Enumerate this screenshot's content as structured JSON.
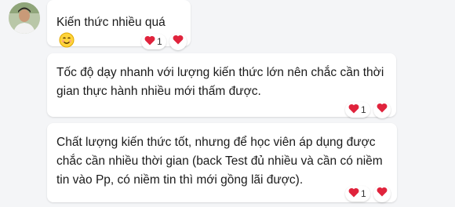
{
  "messages": [
    {
      "text": "Kiến thức nhiều quá",
      "emoji": "smiling-face-emoji",
      "reaction_icon": "heart-icon",
      "reaction_count": "1",
      "react_button_icon": "heart-icon"
    },
    {
      "text": "Tốc độ dạy nhanh với lượng kiến thức lớn nên chắc cần thời\ngian thực hành nhiều mới thấm được.",
      "reaction_icon": "heart-icon",
      "reaction_count": "1",
      "react_button_icon": "heart-icon"
    },
    {
      "text": "Chất lượng kiến thức tốt, nhưng để học viên áp dụng được\nchắc cần nhiều thời gian (back Test đủ nhiều và cần có niềm\ntin vào Pp, có niềm tin thì mới gồng lãi được).",
      "reaction_icon": "heart-icon",
      "reaction_count": "1",
      "react_button_icon": "heart-icon"
    }
  ],
  "colors": {
    "background": "#f4f5f7",
    "bubble": "#ffffff",
    "heart": "#e0233c",
    "text": "#1a1a1a"
  }
}
